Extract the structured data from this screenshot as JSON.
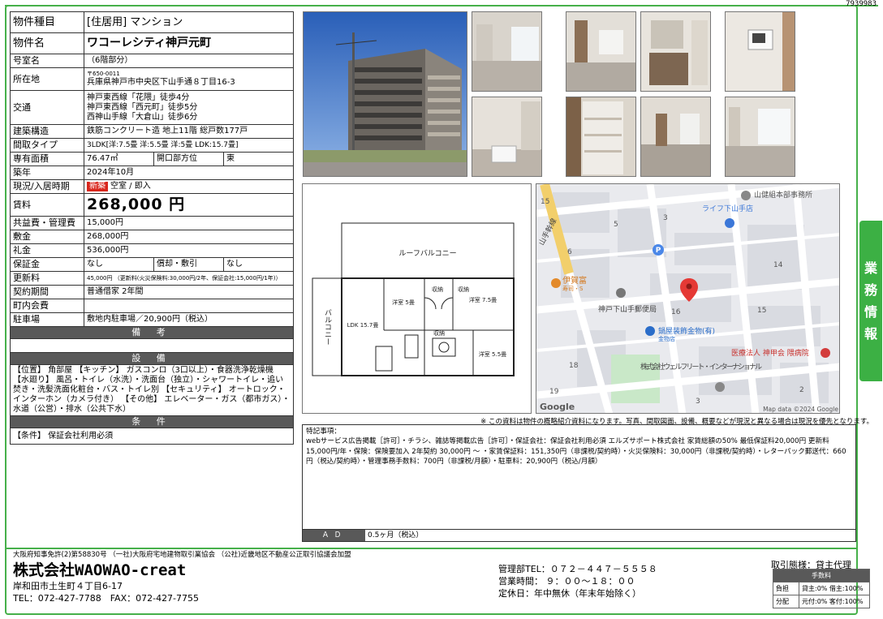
{
  "doc_id": "7939983",
  "side_tab": [
    "業",
    "務",
    "情",
    "報"
  ],
  "spec": {
    "type_label": "物件種目",
    "type_value": "[住居用] マンション",
    "name_label": "物件名",
    "name_value": "ワコーレシティ神戸元町",
    "room_label": "号室名",
    "room_value": "（6階部分）",
    "address_label": "所在地",
    "postal": "〒650-0011",
    "address": "兵庫県神戸市中央区下山手通８丁目16-3",
    "access_label": "交通",
    "access": [
      "神戸東西線「花隈」徒歩4分",
      "神戸東西線「西元町」徒歩5分",
      "西神山手線「大倉山」徒歩6分"
    ],
    "structure_label": "建築構造",
    "structure": "鉄筋コンクリート造 地上11階 総戸数177戸",
    "layout_label": "間取タイプ",
    "layout": "3LDK[洋:7.5畳 洋:5.5畳 洋:5畳 LDK:15.7畳]",
    "area_label": "専有面積",
    "area": "76.47㎡",
    "dir_label": "開口部方位",
    "dir": "東",
    "built_label": "築年",
    "built": "2024年10月",
    "status_label": "現況/入居時期",
    "badge": "新築",
    "status": "空室 / 即入",
    "rent_label": "賃料",
    "rent": "268,000 円",
    "fee_label": "共益費・管理費",
    "fee": "15,000円",
    "deposit_label": "敷金",
    "deposit": "268,000円",
    "key_label": "礼金",
    "key": "536,000円",
    "guarantee_label": "保証金",
    "guarantee": "なし",
    "amort_label": "償却・敷引",
    "amort": "なし",
    "renew_label": "更新料",
    "renew": "45,000円 （更新料(火災保険料:30,000円/2年、保証会社:15,000円/1年)）",
    "contract_label": "契約期間",
    "contract": "普通借家 2年間",
    "town_label": "町内会費",
    "town": "",
    "parking_label": "駐車場",
    "parking": "敷地内駐車場／20,900円（税込）",
    "remarks_head": "備 考",
    "remarks": "",
    "facility_head": "設 備",
    "facilities": "【位置】 角部屋 【キッチン】 ガスコンロ（3口以上）・食器洗浄乾燥機 【水廻り】 風呂・トイレ（水洗）・洗面台（独立）・シャワートイレ・追い焚き・洗髪洗面化粧台・バス・トイレ別 【セキュリティ】 オートロック・インターホン（カメラ付き） 【その他】 エレベーター・ガス（都市ガス）・水道（公営）・排水（公共下水）",
    "cond_head": "条 件",
    "conditions": "【条件】 保証会社利用必須"
  },
  "floorplan": {
    "roof_balcony": "ルーフバルコニー",
    "balcony": "バルコニー",
    "rooms": [
      "洋室 5畳",
      "洋室 7.5畳",
      "LDK 15.7畳",
      "洋室 5.5畳"
    ],
    "storage": "収納"
  },
  "map": {
    "labels": [
      "山健組本部事務所",
      "ライフ下山手店",
      "伊賀富",
      "寿司・S",
      "神戸下山手郵便局",
      "鍋屋装飾金物(有)",
      "金物店",
      "医療法人 神甲会 隈病院",
      "株式会社ウェルフリート・インターナショナル",
      "山手幹線"
    ],
    "numbers": [
      "15",
      "5",
      "3",
      "6",
      "14",
      "16",
      "15",
      "18",
      "19",
      "3",
      "2"
    ],
    "google": "Google",
    "credit": "Map data ©2024 Google"
  },
  "disclaimer": "※ この資料は物件の概略紹介資料になります。写真、間取図面、設備、概要などが現況と異なる場合は現況を優先となります。",
  "notes": {
    "title": "特記事項：",
    "text": "webサービス広告掲載［許可］・チラシ、雑誌等掲載広告［許可］・保証会社：保証会社利用必須 エルズサポート株式会社 家賃総額の50% 最低保証料20,000円 更新料15,000円/年・保険：保険要加入 2年契約 30,000円 〜 ・家賃保証料：151,350円（非課税/契約時）・火災保険料：30,000円（非課税/契約時）・レターパック郵送代：660円（税込/契約時）・管理事務手数料：700円（非課税/月額）・駐車料：20,900円（税込/月額）",
    "ad_label": "ＡＤ",
    "ad_value": "0.5ヶ月（税込）"
  },
  "footer": {
    "license": "大阪府知事免許(2)第58830号 （一社)大阪府宅地建物取引業協会 （公社)近畿地区不動産公正取引協議会加盟",
    "company": "株式会社WAOWAO-creat",
    "address": "岸和田市土生町４丁目6-17",
    "tel": "TEL：072-427-7788　FAX：072-427-7755",
    "mgmt_tel": "管理部TEL：０７２－４４７－５５５８",
    "hours": "営業時間： ９：００～１８：００",
    "holiday": "定休日：年中無休（年末年始除く）",
    "deal": "取引態様：貸主代理",
    "fee_head": "手数料",
    "fee_rows": [
      {
        "k": "負担",
        "v": "貸主:0% 借主:100%"
      },
      {
        "k": "分配",
        "v": "元付:0% 客付:100%"
      }
    ]
  },
  "colors": {
    "accent": "#46b04a",
    "badge": "#d9261c",
    "header": "#595959"
  }
}
